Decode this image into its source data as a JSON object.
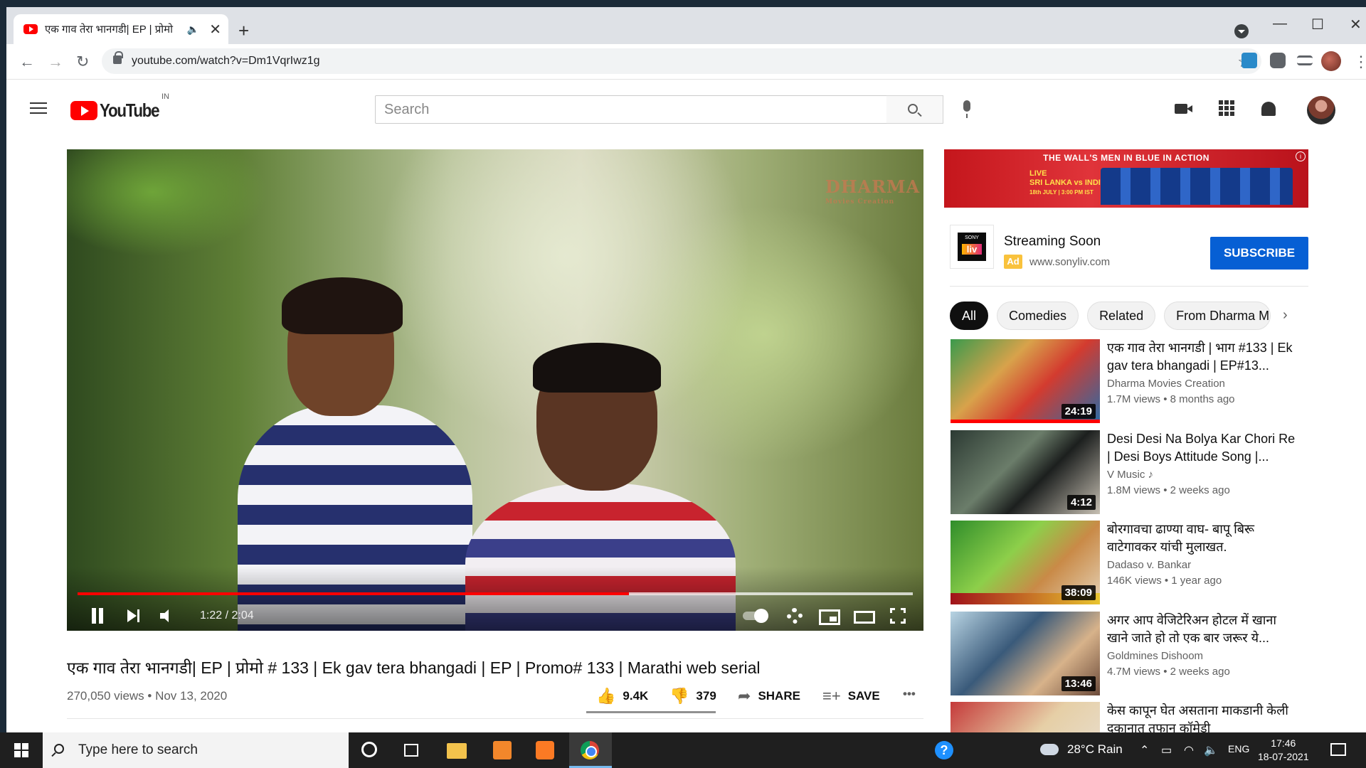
{
  "browser": {
    "tab_title": "एक गाव तेरा भानगडी| EP | प्रोमो",
    "url": "youtube.com/watch?v=Dm1VqrIwz1g",
    "new_tab": "+",
    "tab_close": "✕",
    "audio_icon": "🔈",
    "window_minimize": "—",
    "window_maximize": "☐",
    "window_close": "✕"
  },
  "youtube": {
    "logo_text": "YouTube",
    "country_code": "IN",
    "search_placeholder": "Search"
  },
  "player": {
    "current_time": "1:22",
    "duration": "2:04",
    "time_display": "1:22 / 2:04",
    "played_fraction": 0.66,
    "buffered_fraction": 1.0,
    "watermark": "DHARMA",
    "watermark_sub": "Movies Creation"
  },
  "video": {
    "title": "एक गाव तेरा भानगडी| EP | प्रोमो # 133 | Ek gav tera bhangadi | EP | Promo# 133 | Marathi web serial",
    "views": "270,050 views",
    "date": "Nov 13, 2020",
    "meta": "270,050 views • Nov 13, 2020",
    "likes": "9.4K",
    "dislikes": "379",
    "share_label": "SHARE",
    "save_label": "SAVE",
    "more_label": "•••"
  },
  "ad": {
    "banner_top": "THE WALL'S MEN IN BLUE IN ACTION",
    "banner_match": "SRI LANKA vs INDIA",
    "banner_live": "LIVE",
    "banner_time": "18th JULY | 3:00 PM IST",
    "logo_sony": "SONY",
    "logo_liv": "liv",
    "title": "Streaming Soon",
    "tag": "Ad",
    "url": "www.sonyliv.com",
    "subscribe_label": "SUBSCRIBE"
  },
  "chips": [
    {
      "label": "All"
    },
    {
      "label": "Comedies"
    },
    {
      "label": "Related"
    },
    {
      "label": "From Dharma M"
    }
  ],
  "recommendations": [
    {
      "title": "एक गाव तेरा भानगडी | भाग #133 | Ek gav tera bhangadi | EP#13...",
      "channel": "Dharma Movies Creation",
      "stats": "1.7M views • 8 months ago",
      "duration": "24:19"
    },
    {
      "title": "Desi Desi Na Bolya Kar Chori Re | Desi Boys Attitude Song |...",
      "channel": "V Music ♪",
      "stats": "1.8M views • 2 weeks ago",
      "duration": "4:12"
    },
    {
      "title": "बोरगावचा ढाण्या वाघ- बापू बिरू वाटेगावकर यांची मुलाखत.",
      "channel": "Dadaso v. Bankar",
      "stats": "146K views • 1 year ago",
      "duration": "38:09"
    },
    {
      "title": "अगर आप वेजिटेरिअन होटल में खाना खाने जाते हो तो एक बार जरूर ये...",
      "channel": "Goldmines Dishoom",
      "stats": "4.7M views • 2 weeks ago",
      "duration": "13:46"
    },
    {
      "title": "केस कापून घेत असताना माकडानी केली दुकानात तुफान कॉमेडी",
      "channel": "",
      "stats": "",
      "duration": ""
    }
  ],
  "taskbar": {
    "search_placeholder": "Type here to search",
    "weather_temp": "28°C",
    "weather_text": "Rain",
    "language": "ENG",
    "time": "17:46",
    "date": "18-07-2021"
  }
}
